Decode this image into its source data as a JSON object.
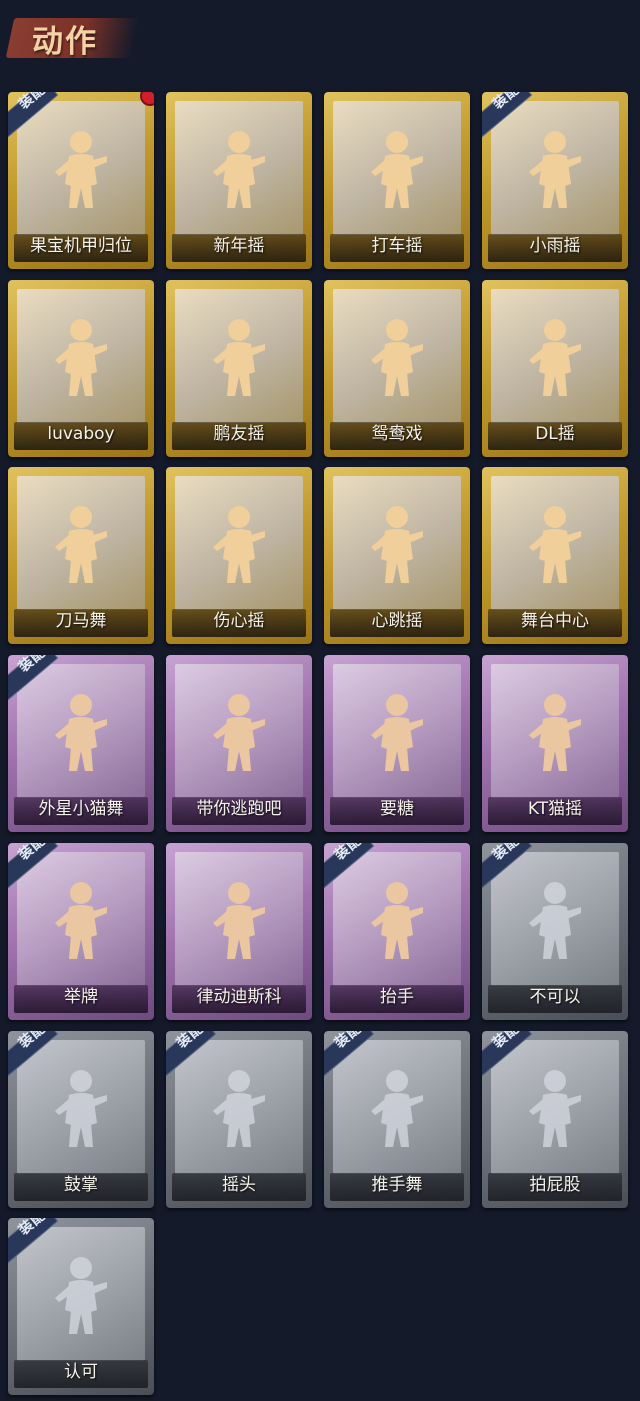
{
  "header": {
    "title": "动作"
  },
  "badge_text": "装配",
  "colors": {
    "background": "#141a2a",
    "gold": "#c19a2c",
    "purple": "#9f72ad",
    "gray": "#6c7079",
    "badge": "#28375a",
    "new_dot": "#d21f2b"
  },
  "cards": [
    {
      "label": "果宝机甲归位",
      "rarity": "gold",
      "equipped": true,
      "new": true
    },
    {
      "label": "新年摇",
      "rarity": "gold",
      "equipped": false
    },
    {
      "label": "打车摇",
      "rarity": "gold",
      "equipped": false
    },
    {
      "label": "小雨摇",
      "rarity": "gold",
      "equipped": true
    },
    {
      "label": "luvaboy",
      "rarity": "gold",
      "equipped": false
    },
    {
      "label": "鹏友摇",
      "rarity": "gold",
      "equipped": false
    },
    {
      "label": "鸳鸯戏",
      "rarity": "gold",
      "equipped": false
    },
    {
      "label": "DL摇",
      "rarity": "gold",
      "equipped": false
    },
    {
      "label": "刀马舞",
      "rarity": "gold",
      "equipped": false
    },
    {
      "label": "伤心摇",
      "rarity": "gold",
      "equipped": false
    },
    {
      "label": "心跳摇",
      "rarity": "gold",
      "equipped": false
    },
    {
      "label": "舞台中心",
      "rarity": "gold",
      "equipped": false
    },
    {
      "label": "外星小猫舞",
      "rarity": "purple",
      "equipped": true
    },
    {
      "label": "带你逃跑吧",
      "rarity": "purple",
      "equipped": false
    },
    {
      "label": "要糖",
      "rarity": "purple",
      "equipped": false
    },
    {
      "label": "KT猫摇",
      "rarity": "purple",
      "equipped": false
    },
    {
      "label": "举牌",
      "rarity": "purple",
      "equipped": true
    },
    {
      "label": "律动迪斯科",
      "rarity": "purple",
      "equipped": false
    },
    {
      "label": "抬手",
      "rarity": "purple",
      "equipped": true
    },
    {
      "label": "不可以",
      "rarity": "gray",
      "equipped": true
    },
    {
      "label": "鼓掌",
      "rarity": "gray",
      "equipped": true
    },
    {
      "label": "摇头",
      "rarity": "gray",
      "equipped": true
    },
    {
      "label": "推手舞",
      "rarity": "gray",
      "equipped": true
    },
    {
      "label": "拍屁股",
      "rarity": "gray",
      "equipped": true
    },
    {
      "label": "认可",
      "rarity": "gray",
      "equipped": true
    }
  ]
}
